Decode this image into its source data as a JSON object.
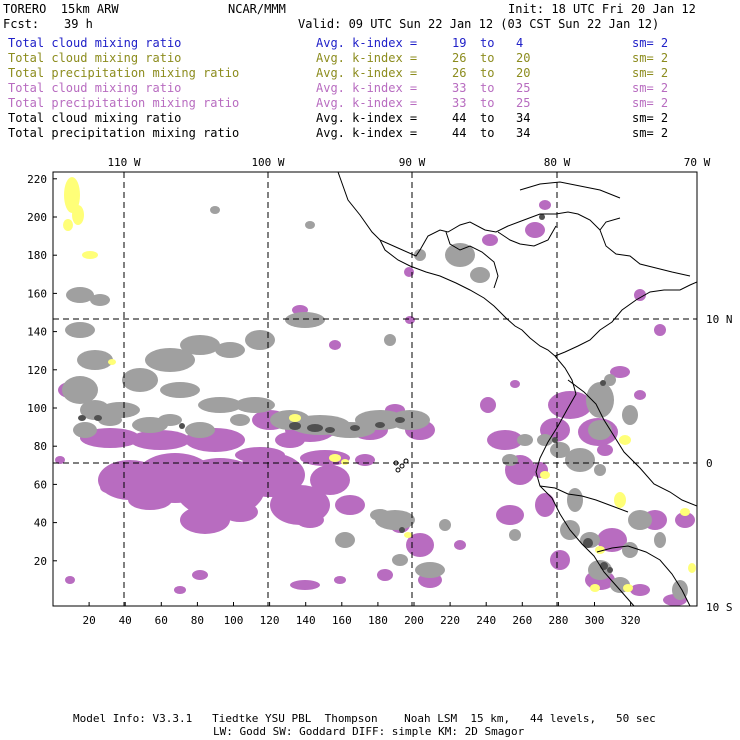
{
  "header": {
    "model": "TORERO  15km ARW",
    "center": "NCAR/MMM",
    "init": "Init: 18 UTC Fri 20 Jan 12",
    "fcst_label": "Fcst:",
    "fcst_value": "39 h",
    "valid": "Valid: 09 UTC Sun 22 Jan 12 (03 CST Sun 22 Jan 12)"
  },
  "legend": [
    {
      "field": "Total cloud mixing ratio",
      "index": "Avg. k-index =",
      "from": "19",
      "to_word": "to",
      "to": "4",
      "sm": "sm= 2",
      "color": "#2020c8"
    },
    {
      "field": "Total cloud mixing ratio",
      "index": "Avg. k-index =",
      "from": "26",
      "to_word": "to",
      "to": "20",
      "sm": "sm= 2",
      "color": "#8c8c1e"
    },
    {
      "field": "Total precipitation mixing ratio",
      "index": "Avg. k-index =",
      "from": "26",
      "to_word": "to",
      "to": "20",
      "sm": "sm= 2",
      "color": "#8c8c1e"
    },
    {
      "field": "Total cloud mixing ratio",
      "index": "Avg. k-index =",
      "from": "33",
      "to_word": "to",
      "to": "25",
      "sm": "sm= 2",
      "color": "#b86cc0"
    },
    {
      "field": "Total precipitation mixing ratio",
      "index": "Avg. k-index =",
      "from": "33",
      "to_word": "to",
      "to": "25",
      "sm": "sm= 2",
      "color": "#b86cc0"
    },
    {
      "field": "Total cloud mixing ratio",
      "index": "Avg. k-index =",
      "from": "44",
      "to_word": "to",
      "to": "34",
      "sm": "sm= 2",
      "color": "#000000"
    },
    {
      "field": "Total precipitation mixing ratio",
      "index": "Avg. k-index =",
      "from": "44",
      "to_word": "to",
      "to": "34",
      "sm": "sm= 2",
      "color": "#000000"
    }
  ],
  "map": {
    "lon_labels": [
      "110 W",
      "100 W",
      "90 W",
      "80 W",
      "70 W"
    ],
    "lat_labels": [
      "10 N",
      "0",
      "10 S"
    ],
    "y_ticks": [
      "220",
      "200",
      "180",
      "160",
      "140",
      "120",
      "100",
      "80",
      "60",
      "40",
      "20"
    ],
    "x_ticks": [
      "20",
      "40",
      "60",
      "80",
      "100",
      "120",
      "140",
      "160",
      "180",
      "200",
      "220",
      "240",
      "260",
      "280",
      "300",
      "320"
    ],
    "colors": {
      "gray": "#a0a0a0",
      "dark_gray": "#505050",
      "purple": "#b86cc0",
      "yellow": "#ffff78",
      "grid": "#000000",
      "coast": "#000000"
    }
  },
  "footer": {
    "line1": "Model Info: V3.3.1   Tiedtke YSU PBL  Thompson    Noah LSM  15 km,   44 levels,   50 sec",
    "line2": "LW: Godd SW: Goddard DIFF: simple KM: 2D Smagor"
  }
}
